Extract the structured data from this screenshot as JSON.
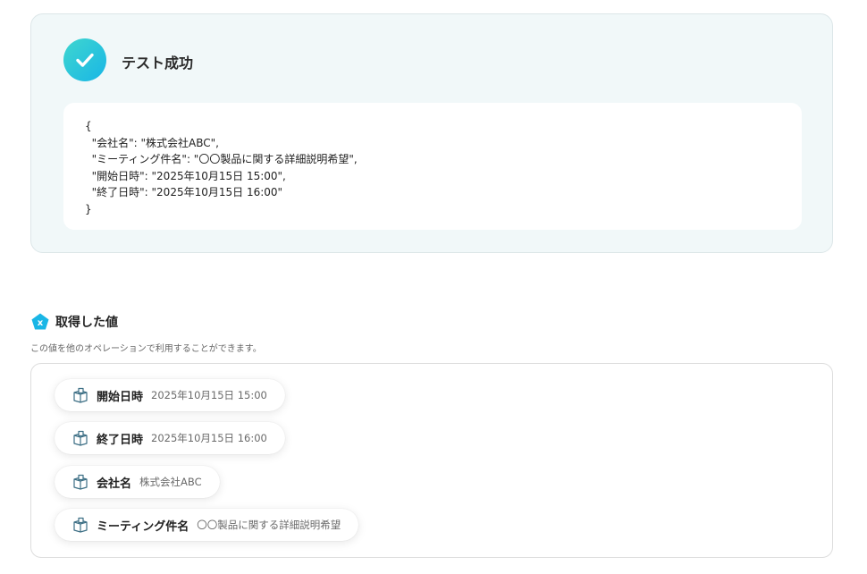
{
  "test_result": {
    "title": "テスト成功",
    "json_output": "{\n  \"会社名\": \"株式会社ABC\",\n  \"ミーティング件名\": \"〇〇製品に関する詳細説明希望\",\n  \"開始日時\": \"2025年10月15日 15:00\",\n  \"終了日時\": \"2025年10月15日 16:00\"\n}"
  },
  "retrieved_values": {
    "title": "取得した値",
    "description": "この値を他のオペレーションで利用することができます。",
    "items": [
      {
        "label": "開始日時",
        "value": "2025年10月15日 15:00"
      },
      {
        "label": "終了日時",
        "value": "2025年10月15日 16:00"
      },
      {
        "label": "会社名",
        "value": "株式会社ABC"
      },
      {
        "label": "ミーティング件名",
        "value": "〇〇製品に関する詳細説明希望"
      }
    ]
  },
  "colors": {
    "accent": "#19b6e6",
    "accent_light": "#3fd6cf",
    "panel_bg": "#f1f8f9"
  },
  "icons": {
    "success": "checkmark-icon",
    "variables": "variable-x-icon",
    "item": "box-icon"
  }
}
